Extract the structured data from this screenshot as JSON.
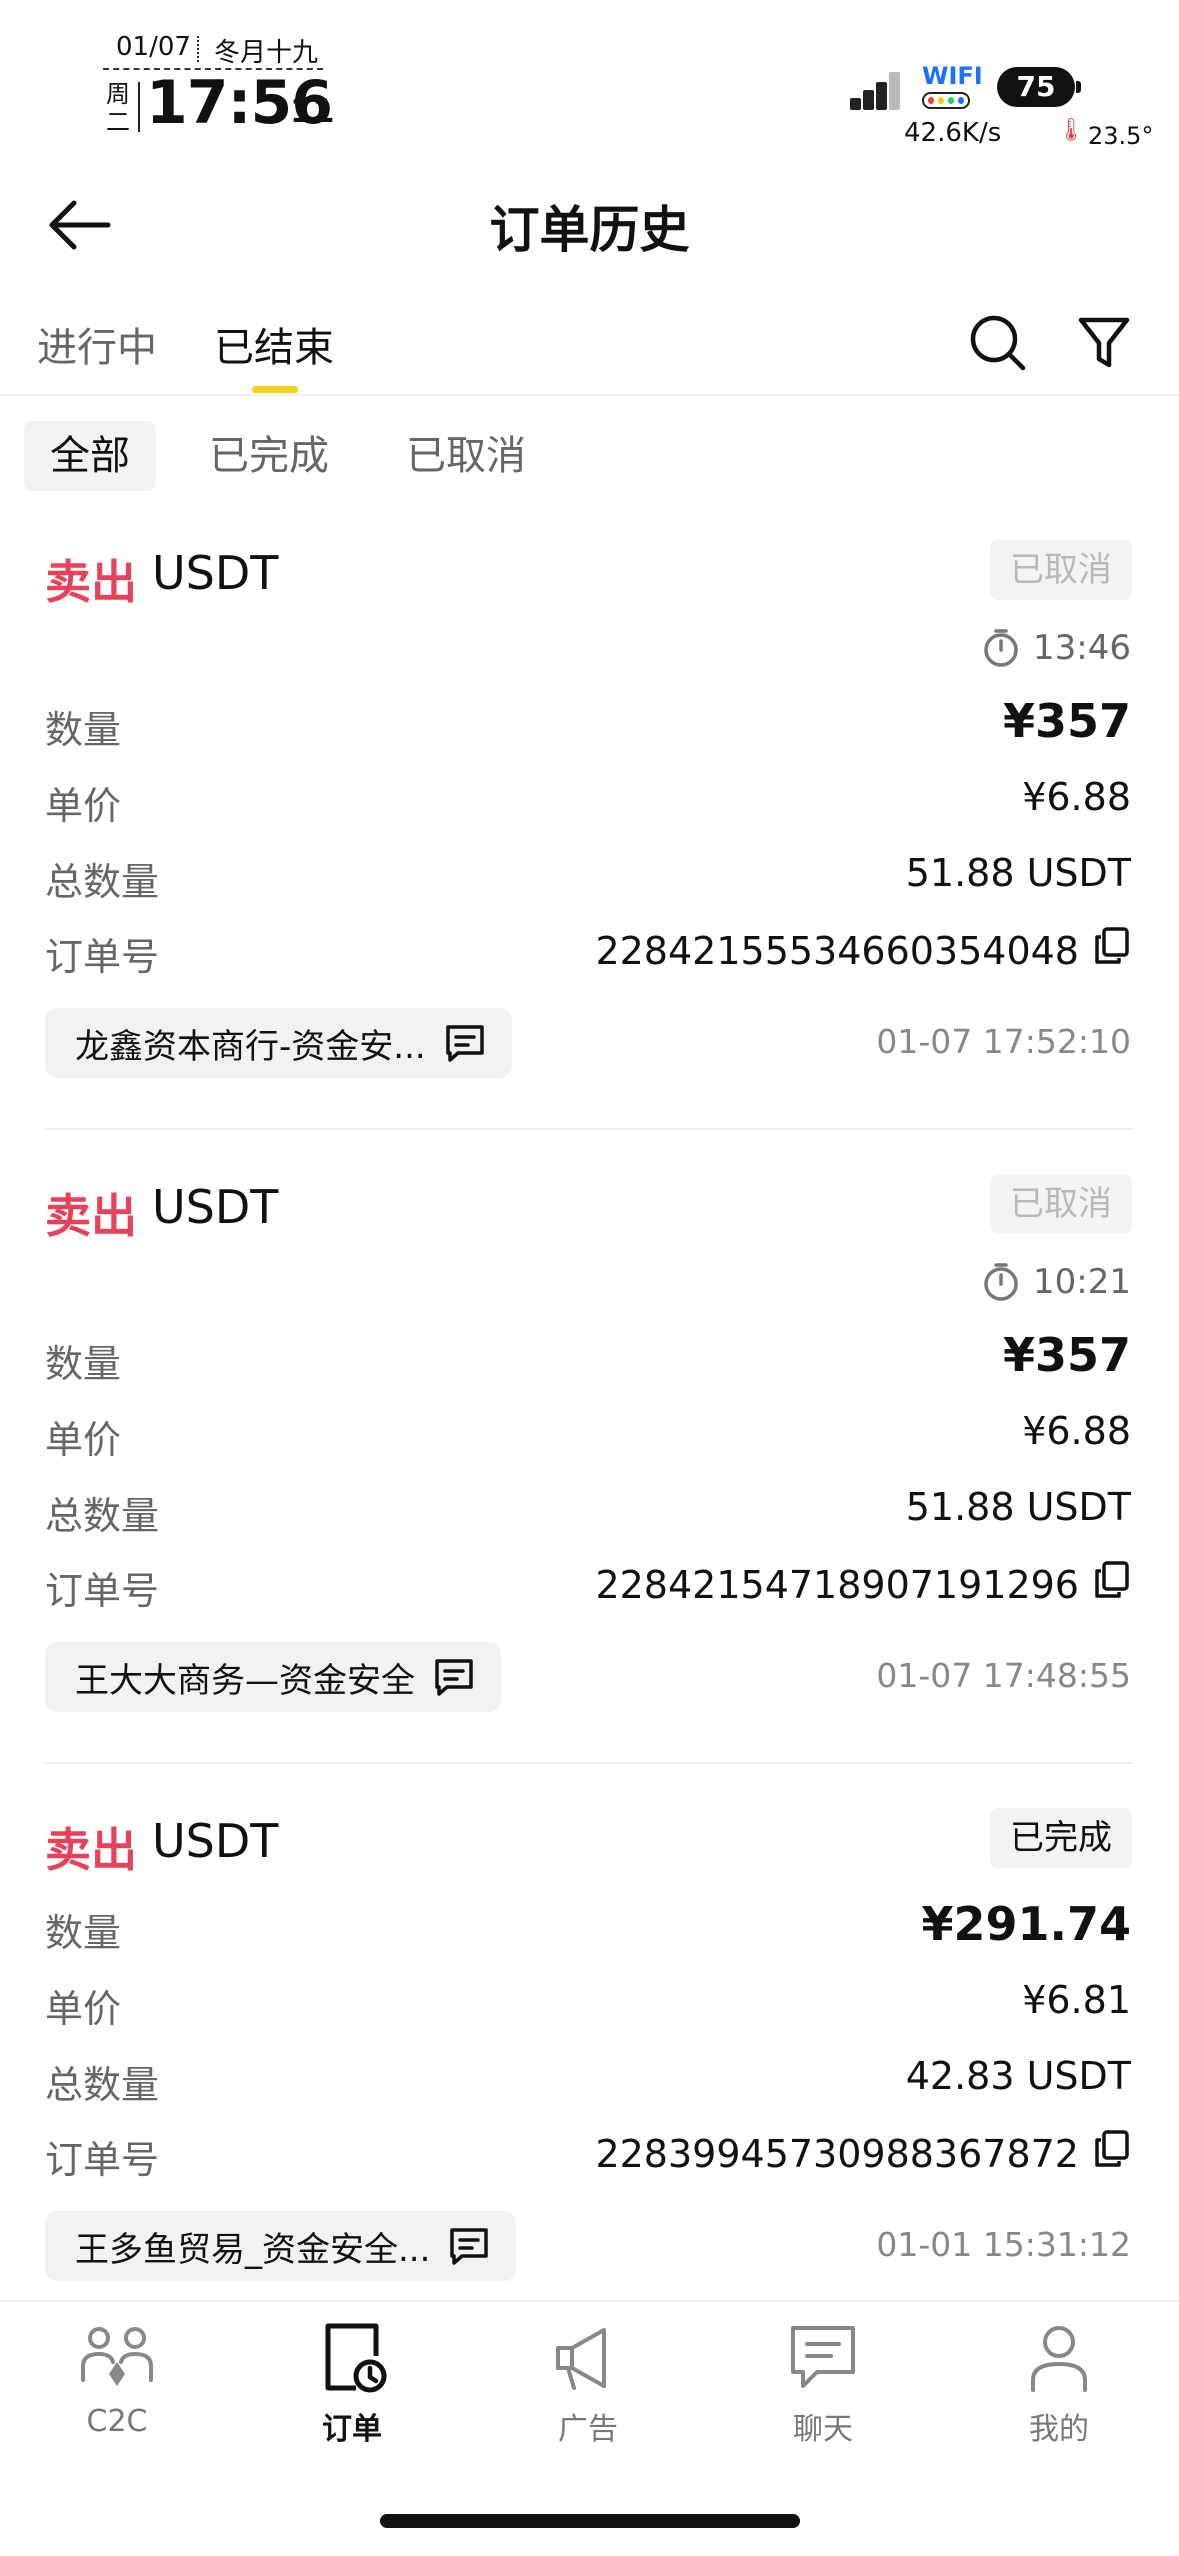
{
  "status_bar": {
    "date": "01/07",
    "lunar": "冬月十九",
    "weekday": "周二",
    "time": "17:56",
    "seconds": "11",
    "wifi_label": "WIFI",
    "battery": "75",
    "net_speed": "42.6K/s",
    "temperature": "23.5°"
  },
  "header": {
    "title": "订单历史"
  },
  "tabs": {
    "ongoing": "进行中",
    "ended": "已结束"
  },
  "filters": {
    "all": "全部",
    "done": "已完成",
    "cancelled": "已取消"
  },
  "labels": {
    "quantity": "数量",
    "unit_price": "单价",
    "total_qty": "总数量",
    "order_no": "订单号"
  },
  "orders": [
    {
      "side": "卖出",
      "asset": "USDT",
      "status": "已取消",
      "timer": "13:46",
      "amount": "¥357",
      "price": "¥6.88",
      "total": "51.88 USDT",
      "order_no": "22842155534660354048",
      "merchant": "龙鑫资本商行-资金安...",
      "datetime": "01-07 17:52:10"
    },
    {
      "side": "卖出",
      "asset": "USDT",
      "status": "已取消",
      "timer": "10:21",
      "amount": "¥357",
      "price": "¥6.88",
      "total": "51.88 USDT",
      "order_no": "22842154718907191296",
      "merchant": "王大大商务—资金安全",
      "datetime": "01-07 17:48:55"
    },
    {
      "side": "卖出",
      "asset": "USDT",
      "status": "已完成",
      "amount": "¥291.74",
      "price": "¥6.81",
      "total": "42.83 USDT",
      "order_no": "22839945730988367872",
      "merchant": "王多鱼贸易_资金安全...",
      "datetime": "01-01 15:31:12"
    }
  ],
  "bottom_nav": [
    {
      "label": "C2C",
      "icon": "c2c-users-icon"
    },
    {
      "label": "订单",
      "icon": "orders-icon"
    },
    {
      "label": "广告",
      "icon": "megaphone-icon"
    },
    {
      "label": "聊天",
      "icon": "chat-icon"
    },
    {
      "label": "我的",
      "icon": "profile-icon"
    }
  ],
  "colors": {
    "sell_red": "#e8425a",
    "tab_indicator": "#f6cf1c",
    "muted_text": "#666666",
    "chip_bg": "#f2f2f2"
  }
}
